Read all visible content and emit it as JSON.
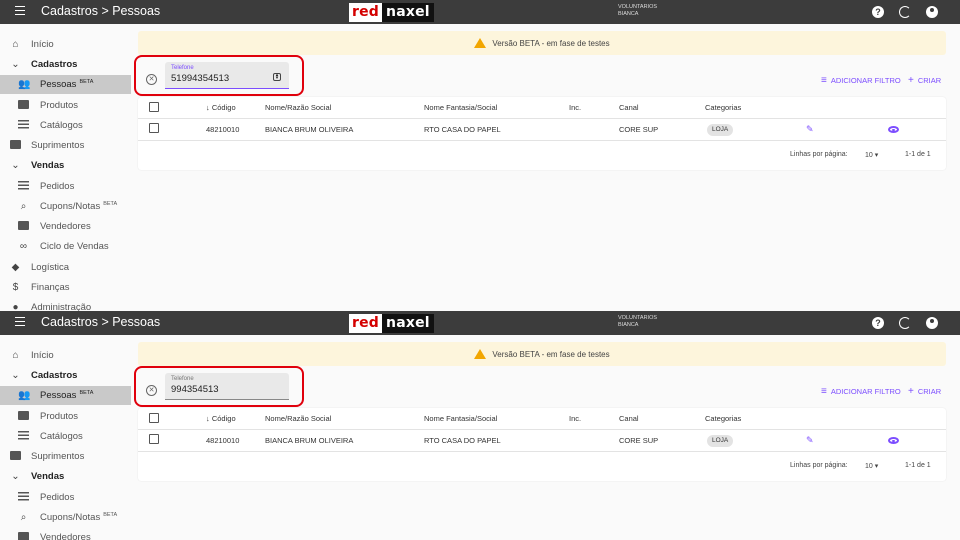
{
  "topbar": {
    "title": "Cadastros > Pessoas",
    "logo_red": "red",
    "logo_dark": "naxel",
    "user_line1": "VOLUNTARIOS",
    "user_line2": "BIANCA",
    "help_glyph": "?"
  },
  "sidebar": {
    "items": [
      {
        "label": "Início",
        "icon": "home-icon"
      },
      {
        "label": "Cadastros",
        "icon": "chevron-down-icon"
      },
      {
        "label": "Pessoas",
        "badge": "BETA",
        "icon": "people-icon"
      },
      {
        "label": "Produtos",
        "icon": "product-icon"
      },
      {
        "label": "Catálogos",
        "icon": "list-icon"
      },
      {
        "label": "Suprimentos",
        "icon": "supplies-icon"
      },
      {
        "label": "Vendas",
        "icon": "chevron-down-icon"
      },
      {
        "label": "Pedidos",
        "icon": "list-icon"
      },
      {
        "label": "Cupons/Notas",
        "badge": "BETA",
        "icon": "coupon-icon"
      },
      {
        "label": "Vendedores",
        "icon": "seller-icon"
      },
      {
        "label": "Ciclo de Vendas",
        "icon": "cycle-icon"
      },
      {
        "label": "Logística",
        "icon": "logistics-icon"
      },
      {
        "label": "Finanças",
        "icon": "finance-icon"
      },
      {
        "label": "Administração",
        "icon": "admin-icon"
      }
    ]
  },
  "banner": {
    "text": "Versão BETA - em fase de testes"
  },
  "filter": {
    "label": "Telefone",
    "value_before": "51994354513",
    "value_after": "994354513"
  },
  "actions": {
    "add_filter": "ADICIONAR FILTRO",
    "create": "CRIAR"
  },
  "table": {
    "headers": [
      "Código",
      "Nome/Razão Social",
      "Nome Fantasia/Social",
      "Inc.",
      "Canal",
      "Categorias"
    ],
    "row": {
      "codigo": "48210010",
      "nome": "BIANCA BRUM OLIVEIRA",
      "fantasia": "RTO CASA DO PAPEL",
      "inc": "",
      "canal": "CORE SUP",
      "categoria": "LOJA"
    },
    "pager": {
      "rows_label": "Linhas por página:",
      "rows_value": "10",
      "range": "1-1 de 1"
    }
  },
  "colors": {
    "accent": "#7c4dff",
    "topbar": "#3c3c3c",
    "highlight": "#e0000c",
    "banner": "#fdf5dc"
  }
}
